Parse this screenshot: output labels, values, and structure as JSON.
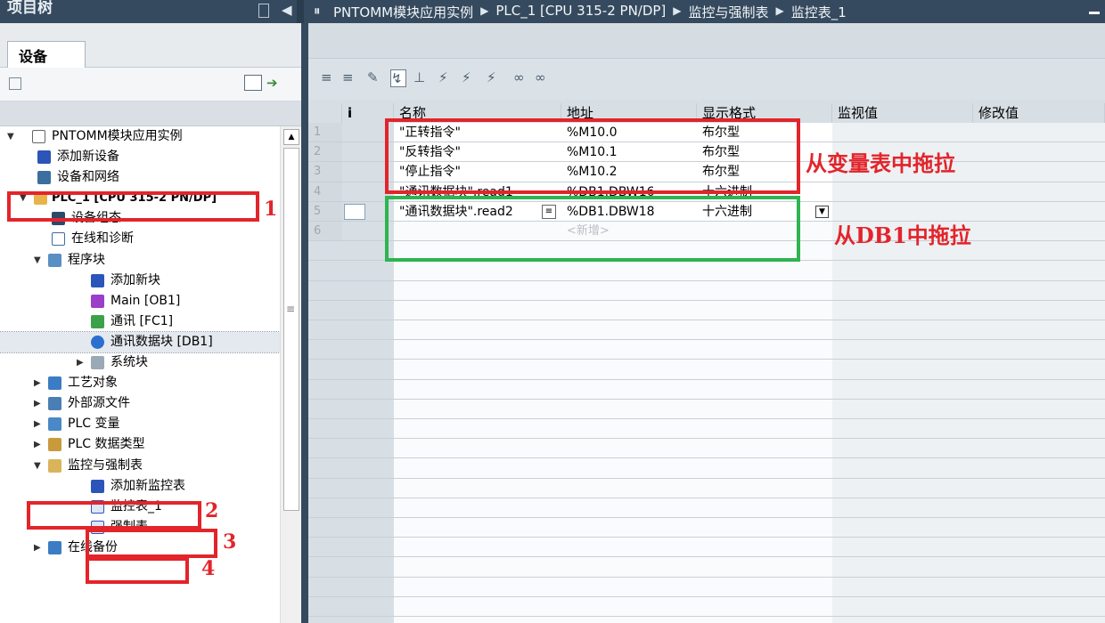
{
  "topbar": {
    "project_panel_title": "项目树",
    "breadcrumbs": [
      "PNTOMM模块应用实例",
      "PLC_1 [CPU 315-2 PN/DP]",
      "监控与强制表",
      "监控表_1"
    ]
  },
  "left_panel": {
    "tab_label": "设备",
    "tree": [
      {
        "label": "PNTOMM模块应用实例",
        "icon": "document-icon"
      },
      {
        "label": "添加新设备",
        "icon": "add-device-icon"
      },
      {
        "label": "设备和网络",
        "icon": "network-icon"
      },
      {
        "label": "PLC_1 [CPU 315-2 PN/DP]",
        "icon": "folder-icon"
      },
      {
        "label": "设备组态",
        "icon": "device-config-icon"
      },
      {
        "label": "在线和诊断",
        "icon": "diagnostic-icon"
      },
      {
        "label": "程序块",
        "icon": "folder-icon"
      },
      {
        "label": "添加新块",
        "icon": "add-block-icon"
      },
      {
        "label": "Main [OB1]",
        "icon": "ob-icon"
      },
      {
        "label": "通讯 [FC1]",
        "icon": "fc-icon"
      },
      {
        "label": "通讯数据块 [DB1]",
        "icon": "db-icon"
      },
      {
        "label": "系统块",
        "icon": "folder-icon"
      },
      {
        "label": "工艺对象",
        "icon": "folder-icon"
      },
      {
        "label": "外部源文件",
        "icon": "folder-icon"
      },
      {
        "label": "PLC 变量",
        "icon": "folder-icon"
      },
      {
        "label": "PLC 数据类型",
        "icon": "folder-icon"
      },
      {
        "label": "监控与强制表",
        "icon": "folder-icon"
      },
      {
        "label": "添加新监控表",
        "icon": "add-table-icon"
      },
      {
        "label": "监控表_1",
        "icon": "watch-table-icon"
      },
      {
        "label": "强制表",
        "icon": "force-table-icon"
      },
      {
        "label": "在线备份",
        "icon": "folder-icon"
      }
    ]
  },
  "table": {
    "headers": [
      "i",
      "名称",
      "地址",
      "显示格式",
      "监视值",
      "修改值"
    ],
    "rows": [
      {
        "idx": "1",
        "name": "\"正转指令\"",
        "addr": "%M10.0",
        "fmt": "布尔型"
      },
      {
        "idx": "2",
        "name": "\"反转指令\"",
        "addr": "%M10.1",
        "fmt": "布尔型"
      },
      {
        "idx": "3",
        "name": "\"停止指令\"",
        "addr": "%M10.2",
        "fmt": "布尔型"
      },
      {
        "idx": "4",
        "name": "\"通讯数据块\".read1",
        "addr": "%DB1.DBW16",
        "fmt": "十六进制"
      },
      {
        "idx": "5",
        "name": "\"通讯数据块\".read2",
        "addr": "%DB1.DBW18",
        "fmt": "十六进制"
      },
      {
        "idx": "6",
        "name": "",
        "addr": "<新增>",
        "fmt": ""
      }
    ]
  },
  "annotations": {
    "n1": "1",
    "n2": "2",
    "n3": "3",
    "n4": "4",
    "from_var_table": "从变量表中拖拉",
    "from_db1": "从DB1中拖拉"
  }
}
